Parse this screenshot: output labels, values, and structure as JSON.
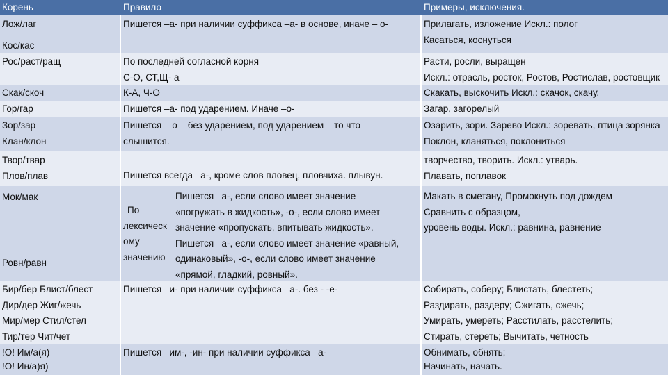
{
  "headers": {
    "root": "Корень",
    "rule": "Правило",
    "examples": "Примеры, исключения."
  },
  "rows": [
    {
      "roots": [
        "Лож/лаг",
        "Кос/кас"
      ],
      "rule": [
        "Пишется –а- при наличии суффикса –а- в основе, иначе – о-"
      ],
      "examples": [
        "Прилагать, изложение       Искл.: полог",
        "Касаться, коснуться"
      ]
    },
    {
      "roots": [
        "Рос/раст/ращ"
      ],
      "rule": [
        "По последней согласной корня",
        "С-О, СТ,Щ- а"
      ],
      "examples": [
        "Расти, росли, выращен",
        "Искл.: отрасль, росток, Ростов, Ростислав, ростовщик"
      ]
    },
    {
      "roots": [
        "Скак/скоч"
      ],
      "rule": [
        "К-А, Ч-О"
      ],
      "examples": [
        "Скакать, выскочить        Искл.: скачок, скачу."
      ]
    },
    {
      "roots": [
        "Гор/гар"
      ],
      "rule": [
        "Пишется –а- под ударением. Иначе –о-"
      ],
      "examples": [
        "Загар, загорелый"
      ]
    },
    {
      "roots": [
        "Зор/зар",
        "Клан/клон"
      ],
      "rule": [
        "Пишется – о – без ударением, под ударением – то что",
        "слышится."
      ],
      "examples": [
        "Озарить, зори. Зарево  Искл.: зоревать, птица зорянка",
        "Поклон, кланяться, поклониться"
      ]
    },
    {
      "roots": [
        "Твор/твар",
        "Плов/плав"
      ],
      "rule": [
        "Пишется всегда –а-, кроме слов пловец, пловчиха. плывун."
      ],
      "examples": [
        "творчество, творить.              Искл.:  утварь.",
        "Плавать, поплавок"
      ]
    },
    {
      "roots": [
        "Мок/мак",
        "Ровн/равн"
      ],
      "rule_side": [
        "По",
        "лексическ",
        "ому",
        "значению"
      ],
      "rule": [
        "Пишется –а-, если слово имеет значение",
        "«погружать в жидкость», -о-, если слово имеет",
        "значение «пропускать, впитывать жидкость».",
        "Пишется –а-, если слово имеет значение «равный,",
        "одинаковый», -о-, если слово имеет значение",
        "«прямой, гладкий, ровный»."
      ],
      "examples": [
        "Макать в сметану,       Промокнуть под дождем",
        "",
        "",
        "Сравнить с образцом,",
        "уровень воды.      Искл.: равнина, равнение"
      ]
    },
    {
      "roots": [
        "Бир/бер   Блист/блест",
        "Дир/дер    Жиг/жечь",
        "Мир/мер    Стил/стел",
        "Тир/тер       Чит/чет"
      ],
      "rule": [
        "Пишется –и- при наличии суффикса –а-. без - -е-"
      ],
      "examples": [
        "Собирать, соберу;        Блистать, блестеть;",
        "Раздирать, раздеру;             Сжигать, сжечь;",
        "Умирать, умереть;       Расстилать, расстелить;",
        "Стирать, стереть;     Вычитать, четность"
      ]
    },
    {
      "roots": [
        "!О! Им/а(я)",
        "!О! Ин/а)я)"
      ],
      "rule": [
        "Пишется –им-, -ин- при наличии суффикса –а-"
      ],
      "examples": [
        "Обнимать, обнять;",
        "Начинать, начать."
      ]
    }
  ]
}
